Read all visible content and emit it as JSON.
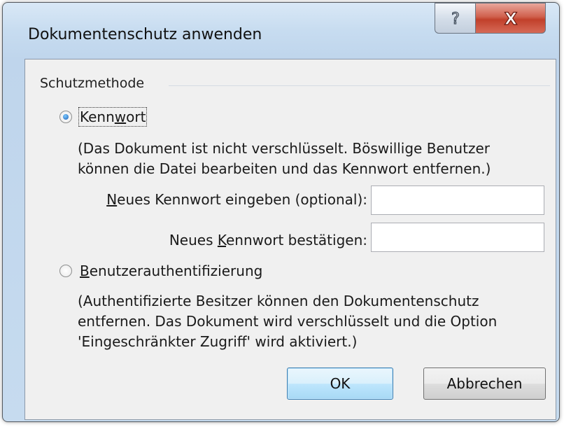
{
  "dialog": {
    "title": "Dokumentenschutz anwenden",
    "help_symbol": "?",
    "close_symbol": "X"
  },
  "group": {
    "label": "Schutzmethode"
  },
  "password_option": {
    "label_before": "Kenn",
    "label_mnemonic": "w",
    "label_after": "ort",
    "selected": true,
    "description_line1": "(Das Dokument ist nicht verschlüsselt. Böswillige Benutzer",
    "description_line2": "können die Datei bearbeiten und das Kennwort entfernen.)",
    "new_password": {
      "label_mnemonic": "N",
      "label_after": "eues Kennwort eingeben (optional):",
      "value": ""
    },
    "confirm_password": {
      "label_before": "Neues ",
      "label_mnemonic": "K",
      "label_after": "ennwort bestätigen:",
      "value": ""
    }
  },
  "auth_option": {
    "label_mnemonic": "B",
    "label_after": "enutzerauthentifizierung",
    "selected": false,
    "description_line1": "(Authentifizierte Besitzer können den Dokumentenschutz",
    "description_line2": "entfernen. Das Dokument wird verschlüsselt und die Option",
    "description_line3": "'Eingeschränkter Zugriff' wird aktiviert.)"
  },
  "buttons": {
    "ok_label": "OK",
    "cancel_label": "Abbrechen"
  },
  "colors": {
    "frame": "#c6dbef",
    "client": "#f0f0f0",
    "close_button": "#c1402b",
    "default_button_border": "#3c7fb1"
  }
}
